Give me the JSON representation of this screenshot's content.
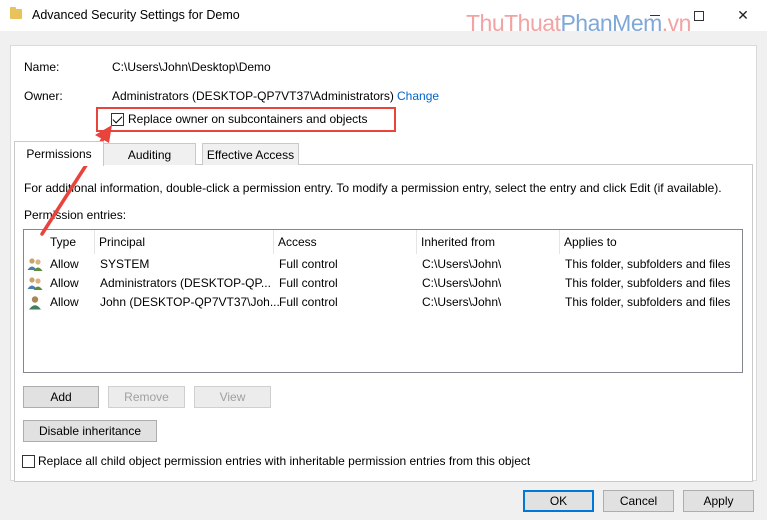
{
  "window": {
    "title": "Advanced Security Settings for Demo",
    "watermark_part1": "ThuThuat",
    "watermark_part2": "PhanMem",
    "watermark_part3": ".vn",
    "minimize": "",
    "maximize": "",
    "close": "✕"
  },
  "info": {
    "name_label": "Name:",
    "name_value": "C:\\Users\\John\\Desktop\\Demo",
    "owner_label": "Owner:",
    "owner_value": "Administrators (DESKTOP-QP7VT37\\Administrators)",
    "change_link": "Change",
    "replace_owner_label": "Replace owner on subcontainers and objects",
    "replace_owner_checked": true
  },
  "tabs": [
    {
      "label": "Permissions",
      "active": true
    },
    {
      "label": "Auditing",
      "active": false
    },
    {
      "label": "Effective Access",
      "active": false
    }
  ],
  "panel": {
    "info_text": "For additional information, double-click a permission entry. To modify a permission entry, select the entry and click Edit (if available).",
    "entries_label": "Permission entries:"
  },
  "table": {
    "columns": [
      "Type",
      "Principal",
      "Access",
      "Inherited from",
      "Applies to"
    ],
    "rows": [
      {
        "icon": "user-group-icon",
        "type": "Allow",
        "principal": "SYSTEM",
        "access": "Full control",
        "inherited": "C:\\Users\\John\\",
        "applies": "This folder, subfolders and files"
      },
      {
        "icon": "user-group-icon",
        "type": "Allow",
        "principal": "Administrators (DESKTOP-QP...",
        "access": "Full control",
        "inherited": "C:\\Users\\John\\",
        "applies": "This folder, subfolders and files"
      },
      {
        "icon": "user-icon",
        "type": "Allow",
        "principal": "John (DESKTOP-QP7VT37\\Joh...",
        "access": "Full control",
        "inherited": "C:\\Users\\John\\",
        "applies": "This folder, subfolders and files"
      }
    ]
  },
  "buttons": {
    "add": "Add",
    "remove": "Remove",
    "view": "View",
    "disable_inheritance": "Disable inheritance",
    "ok": "OK",
    "cancel": "Cancel",
    "apply": "Apply"
  },
  "replace_child": {
    "label": "Replace all child object permission entries with inheritable permission entries from this object",
    "checked": false
  },
  "colors": {
    "accent": "#0078d7",
    "annotation": "#e8433c",
    "link": "#0066cc"
  }
}
